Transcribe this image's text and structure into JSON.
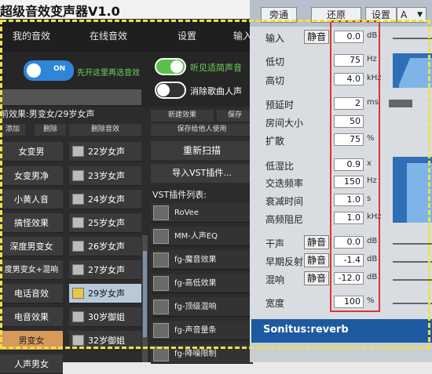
{
  "app": {
    "title": "超级音效变声器V1.0"
  },
  "tabs": [
    "我的音效",
    "在线音效",
    "设置",
    "输入"
  ],
  "toggles": {
    "main_on_label": "ON",
    "main_hint": "先开这里再选音效",
    "clear_voice": "听见适简声音",
    "remove_vocal": "消除歌曲人声"
  },
  "current": {
    "label": "前效果:男变女/29岁女声"
  },
  "header_buttons": {
    "add": "添加",
    "delete": "删除",
    "delete_effect": "删除音效"
  },
  "categories": [
    "女变男",
    "女变男净",
    "小黄人音",
    "搞怪效果",
    "深度男变女",
    "度男变女+混响",
    "电话音效",
    "电音效果",
    "男变女",
    "人声男女"
  ],
  "voices": [
    "22岁女声",
    "23岁女声",
    "24岁女声",
    "25岁女声",
    "26岁女声",
    "27岁女声",
    "29岁女声",
    "30岁御姐",
    "32岁御姐"
  ],
  "vst": {
    "new_effect": "新建效果",
    "save": "保存",
    "save_personal": "保存给他人使用",
    "rescan": "重新扫描",
    "import": "导入VST插件...",
    "list_label": "VST插件列表:",
    "plugins": [
      "RoVee",
      "MM-人声EQ",
      "fg-魔音效果",
      "fg-高低效果",
      "fg-顶级混响",
      "fg-声音量条",
      "fg-降噪限制"
    ]
  },
  "panel": {
    "bypass": "旁通",
    "restore": "还原",
    "settings": "设置",
    "preset": "A",
    "params": [
      {
        "label": "输入",
        "value": "0.0",
        "unit": "dB",
        "mute": "静音"
      },
      {
        "label": "低切",
        "value": "75",
        "unit": "Hz"
      },
      {
        "label": "高切",
        "value": "4.0",
        "unit": "kHz"
      },
      {
        "label": "预延时",
        "value": "2",
        "unit": "ms"
      },
      {
        "label": "房间大小",
        "value": "50",
        "unit": ""
      },
      {
        "label": "扩散",
        "value": "75",
        "unit": "%"
      },
      {
        "label": "低湿比",
        "value": "0.9",
        "unit": "x"
      },
      {
        "label": "交迭频率",
        "value": "150",
        "unit": "Hz"
      },
      {
        "label": "衰减时间",
        "value": "1.0",
        "unit": "s"
      },
      {
        "label": "高频阻尼",
        "value": "1.0",
        "unit": "kHz"
      },
      {
        "label": "干声",
        "value": "0.0",
        "unit": "dB",
        "mute": "静音"
      },
      {
        "label": "早期反射",
        "value": "-1.4",
        "unit": "dB",
        "mute": "静音"
      },
      {
        "label": "混响",
        "value": "-12.0",
        "unit": "dB",
        "mute": "静音"
      },
      {
        "label": "宽度",
        "value": "100",
        "unit": "%"
      }
    ],
    "brand": "Sonitus:reverb"
  },
  "colors": {
    "accent": "#1e5aa0",
    "highlight": "#d9343a",
    "dash": "#f0e23c",
    "toggle_on": "#2e86d9",
    "toggle_green": "#5ac04a"
  }
}
